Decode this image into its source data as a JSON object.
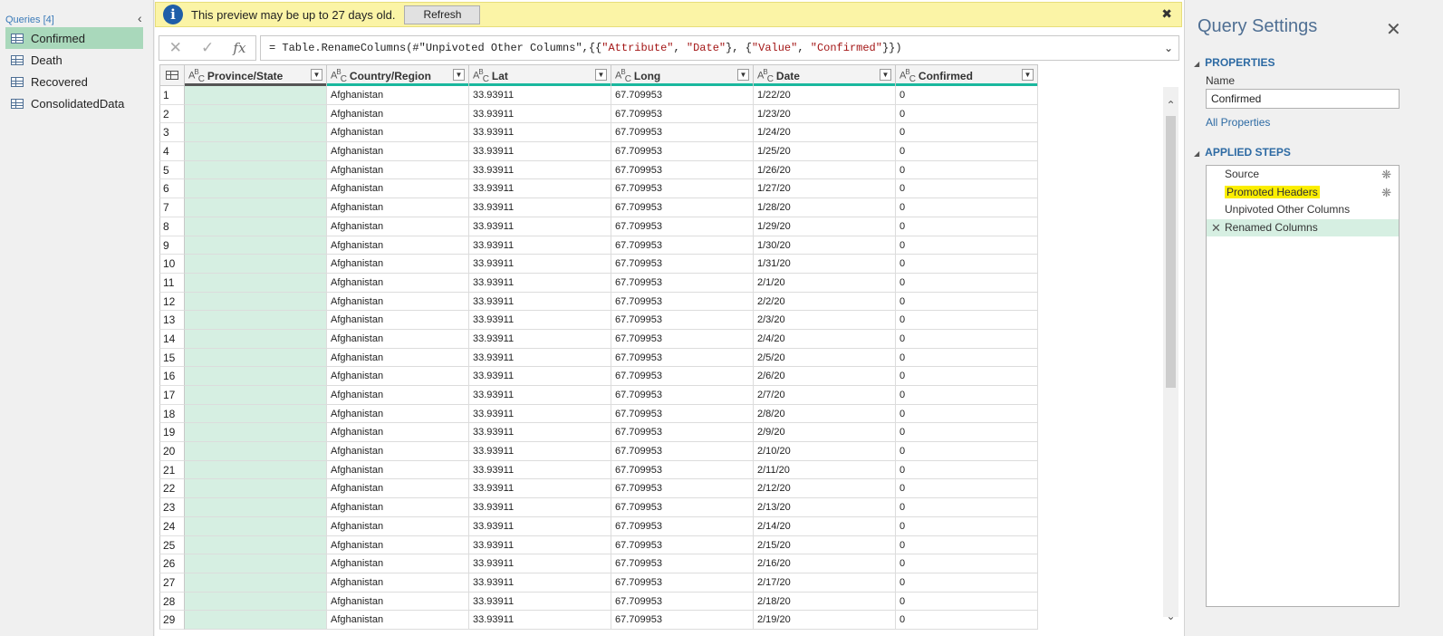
{
  "queries": {
    "header": "Queries [4]",
    "items": [
      {
        "label": "Confirmed",
        "active": true
      },
      {
        "label": "Death",
        "active": false
      },
      {
        "label": "Recovered",
        "active": false
      },
      {
        "label": "ConsolidatedData",
        "active": false
      }
    ]
  },
  "banner": {
    "text": "This preview may be up to 27 days old.",
    "refresh_label": "Refresh"
  },
  "formula": {
    "prefix": "= Table.RenameColumns(#\"Unpivoted Other Columns\",{{",
    "s1": "\"Attribute\"",
    "sep1": ", ",
    "s2": "\"Date\"",
    "sep2": "}, {",
    "s3": "\"Value\"",
    "sep3": ", ",
    "s4": "\"Confirmed\"",
    "suffix": "}})"
  },
  "grid": {
    "columns": [
      {
        "label": "Province/State"
      },
      {
        "label": "Country/Region"
      },
      {
        "label": "Lat"
      },
      {
        "label": "Long"
      },
      {
        "label": "Date"
      },
      {
        "label": "Confirmed"
      }
    ],
    "rows": [
      [
        "",
        "Afghanistan",
        "33.93911",
        "67.709953",
        "1/22/20",
        "0"
      ],
      [
        "",
        "Afghanistan",
        "33.93911",
        "67.709953",
        "1/23/20",
        "0"
      ],
      [
        "",
        "Afghanistan",
        "33.93911",
        "67.709953",
        "1/24/20",
        "0"
      ],
      [
        "",
        "Afghanistan",
        "33.93911",
        "67.709953",
        "1/25/20",
        "0"
      ],
      [
        "",
        "Afghanistan",
        "33.93911",
        "67.709953",
        "1/26/20",
        "0"
      ],
      [
        "",
        "Afghanistan",
        "33.93911",
        "67.709953",
        "1/27/20",
        "0"
      ],
      [
        "",
        "Afghanistan",
        "33.93911",
        "67.709953",
        "1/28/20",
        "0"
      ],
      [
        "",
        "Afghanistan",
        "33.93911",
        "67.709953",
        "1/29/20",
        "0"
      ],
      [
        "",
        "Afghanistan",
        "33.93911",
        "67.709953",
        "1/30/20",
        "0"
      ],
      [
        "",
        "Afghanistan",
        "33.93911",
        "67.709953",
        "1/31/20",
        "0"
      ],
      [
        "",
        "Afghanistan",
        "33.93911",
        "67.709953",
        "2/1/20",
        "0"
      ],
      [
        "",
        "Afghanistan",
        "33.93911",
        "67.709953",
        "2/2/20",
        "0"
      ],
      [
        "",
        "Afghanistan",
        "33.93911",
        "67.709953",
        "2/3/20",
        "0"
      ],
      [
        "",
        "Afghanistan",
        "33.93911",
        "67.709953",
        "2/4/20",
        "0"
      ],
      [
        "",
        "Afghanistan",
        "33.93911",
        "67.709953",
        "2/5/20",
        "0"
      ],
      [
        "",
        "Afghanistan",
        "33.93911",
        "67.709953",
        "2/6/20",
        "0"
      ],
      [
        "",
        "Afghanistan",
        "33.93911",
        "67.709953",
        "2/7/20",
        "0"
      ],
      [
        "",
        "Afghanistan",
        "33.93911",
        "67.709953",
        "2/8/20",
        "0"
      ],
      [
        "",
        "Afghanistan",
        "33.93911",
        "67.709953",
        "2/9/20",
        "0"
      ],
      [
        "",
        "Afghanistan",
        "33.93911",
        "67.709953",
        "2/10/20",
        "0"
      ],
      [
        "",
        "Afghanistan",
        "33.93911",
        "67.709953",
        "2/11/20",
        "0"
      ],
      [
        "",
        "Afghanistan",
        "33.93911",
        "67.709953",
        "2/12/20",
        "0"
      ],
      [
        "",
        "Afghanistan",
        "33.93911",
        "67.709953",
        "2/13/20",
        "0"
      ],
      [
        "",
        "Afghanistan",
        "33.93911",
        "67.709953",
        "2/14/20",
        "0"
      ],
      [
        "",
        "Afghanistan",
        "33.93911",
        "67.709953",
        "2/15/20",
        "0"
      ],
      [
        "",
        "Afghanistan",
        "33.93911",
        "67.709953",
        "2/16/20",
        "0"
      ],
      [
        "",
        "Afghanistan",
        "33.93911",
        "67.709953",
        "2/17/20",
        "0"
      ],
      [
        "",
        "Afghanistan",
        "33.93911",
        "67.709953",
        "2/18/20",
        "0"
      ],
      [
        "",
        "Afghanistan",
        "33.93911",
        "67.709953",
        "2/19/20",
        "0"
      ]
    ]
  },
  "settings": {
    "title": "Query Settings",
    "properties_title": "PROPERTIES",
    "name_label": "Name",
    "name_value": "Confirmed",
    "all_properties": "All Properties",
    "steps_title": "APPLIED STEPS",
    "steps": [
      {
        "label": "Source",
        "gear": true,
        "highlight": false,
        "active": false
      },
      {
        "label": "Promoted Headers",
        "gear": true,
        "highlight": true,
        "active": false
      },
      {
        "label": "Unpivoted Other Columns",
        "gear": false,
        "highlight": false,
        "active": false
      },
      {
        "label": "Renamed Columns",
        "gear": false,
        "highlight": false,
        "active": true
      }
    ]
  },
  "colors": {
    "accent": "#1ab89e",
    "selected_row": "#a9d8bb",
    "banner": "#fbf4a6",
    "highlight": "#fbee00"
  }
}
